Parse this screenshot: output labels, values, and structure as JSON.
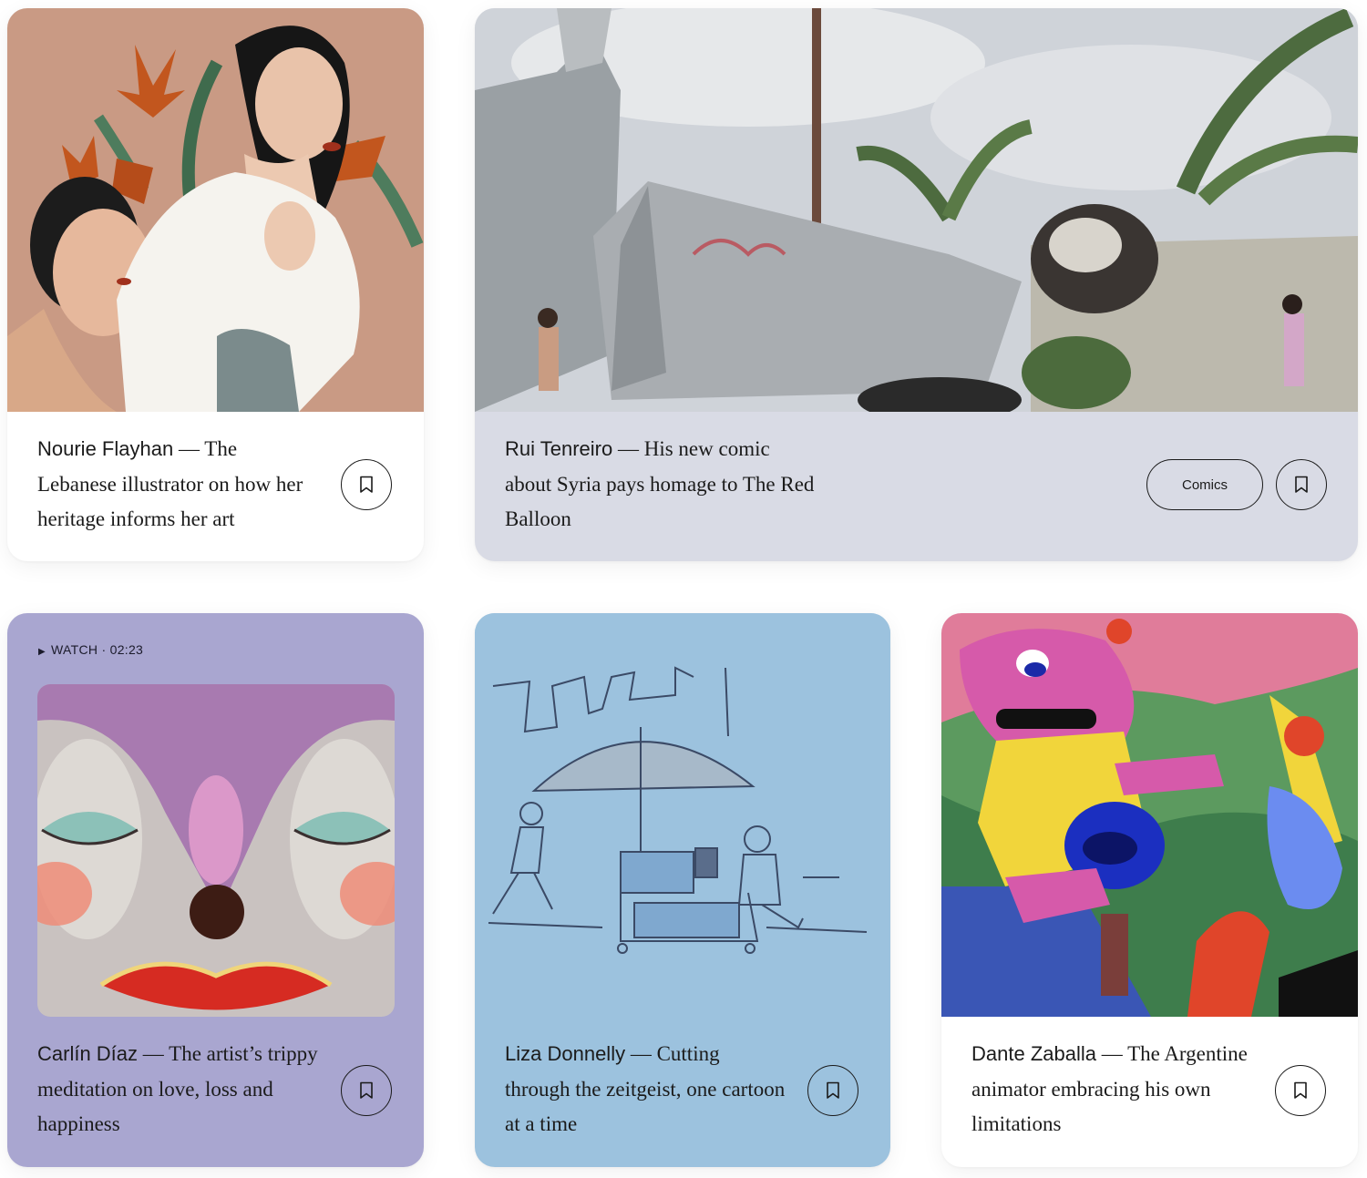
{
  "cards": [
    {
      "name": "Nourie Flayhan",
      "separator": " — ",
      "description": "The Lebanese illustrator on how her heritage informs her art",
      "bookmark_icon": "bookmark-icon",
      "bg": "#ffffff"
    },
    {
      "name": "Rui Tenreiro",
      "separator": " — ",
      "description": "His new comic about Syria pays homage to The Red Balloon",
      "tag": "Comics",
      "bookmark_icon": "bookmark-icon",
      "bg": "#d9dbe5"
    },
    {
      "watch_label": "WATCH · 02:23",
      "name": "Carlín Díaz",
      "separator": " — ",
      "description": "The artist’s trippy meditation on love, loss and happiness",
      "bookmark_icon": "bookmark-icon",
      "bg": "#a9a6d0"
    },
    {
      "name": "Liza Donnelly",
      "separator": " — ",
      "description": "Cutting through the zeitgeist, one cartoon at a time",
      "bookmark_icon": "bookmark-icon",
      "bg": "#9cc2de"
    },
    {
      "name": "Dante Zaballa",
      "separator": " — ",
      "description": "The Argentine animator embracing his own limitations",
      "bookmark_icon": "bookmark-icon",
      "bg": "#ffffff"
    }
  ]
}
